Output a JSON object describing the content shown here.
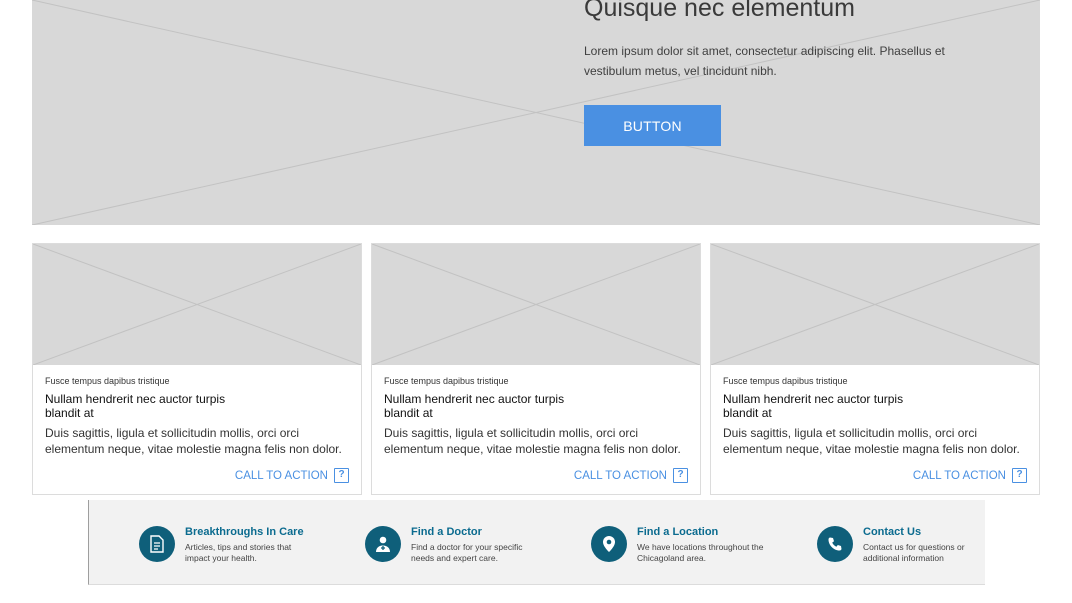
{
  "hero": {
    "title": "Quisque nec elementum",
    "text": "Lorem ipsum dolor sit amet, consectetur adipiscing elit. Phasellus et vestibulum metus, vel tincidunt nibh.",
    "button_label": "BUTTON",
    "button_color": "#4a90e2"
  },
  "cards": [
    {
      "eyebrow": "Fusce tempus dapibus tristique",
      "title": "Nullam hendrerit nec auctor turpis blandit at",
      "body": "Duis sagittis, ligula et sollicitudin mollis, orci orci elementum neque, vitae molestie magna felis non dolor.",
      "cta": "CALL TO ACTION",
      "cta_icon": "question-icon"
    },
    {
      "eyebrow": "Fusce tempus dapibus tristique",
      "title": "Nullam hendrerit nec auctor turpis blandit at",
      "body": "Duis sagittis, ligula et sollicitudin mollis, orci orci elementum neque, vitae molestie magna felis non dolor.",
      "cta": "CALL TO ACTION",
      "cta_icon": "question-icon"
    },
    {
      "eyebrow": "Fusce tempus dapibus tristique",
      "title": "Nullam hendrerit nec auctor turpis blandit at",
      "body": "Duis sagittis, ligula et sollicitudin mollis, orci orci elementum neque, vitae molestie magna felis non dolor.",
      "cta": "CALL TO ACTION",
      "cta_icon": "question-icon"
    }
  ],
  "quick_links": [
    {
      "icon": "document-icon",
      "title": "Breakthroughs In Care",
      "desc": "Articles, tips and stories that impact your health."
    },
    {
      "icon": "doctor-icon",
      "title": "Find a Doctor",
      "desc": "Find a doctor for your specific needs and expert care."
    },
    {
      "icon": "location-pin-icon",
      "title": "Find a Location",
      "desc": "We have locations throughout the Chicagoland area."
    },
    {
      "icon": "phone-icon",
      "title": "Contact Us",
      "desc": "Contact us for questions or additional information"
    }
  ],
  "colors": {
    "placeholder_bg": "#d8d8d8",
    "link_blue": "#4a90e2",
    "icon_circle": "#0f5f7a",
    "link_title": "#0b6b8f"
  },
  "cta_glyph": "?"
}
